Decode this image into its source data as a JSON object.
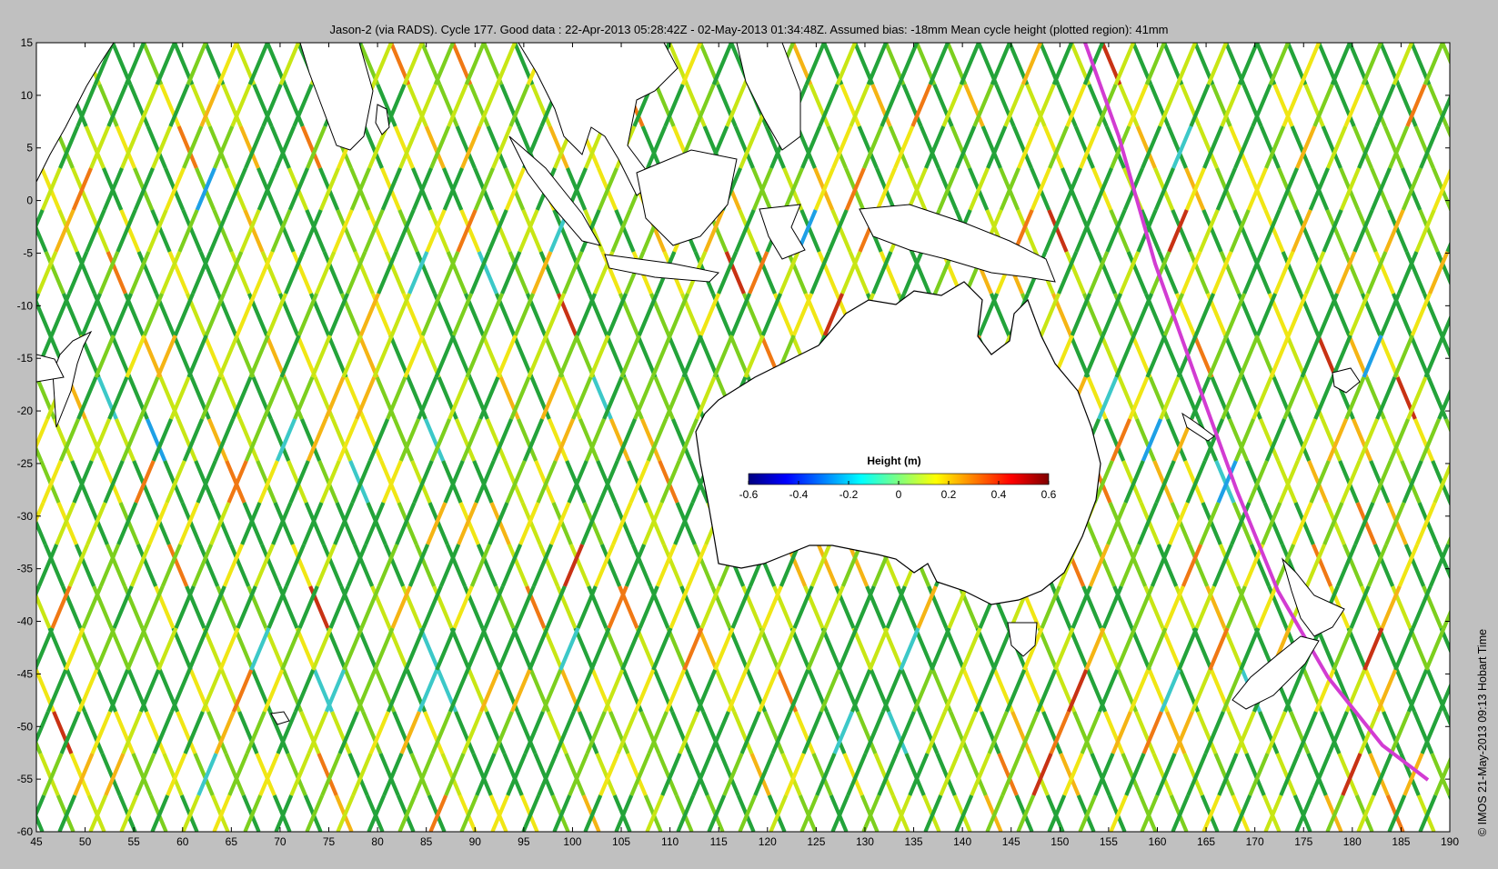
{
  "title": "Jason-2 (via RADS). Cycle 177. Good data : 22-Apr-2013 05:28:42Z - 02-May-2013 01:34:48Z. Assumed bias: -18mm  Mean cycle height (plotted region): 41mm",
  "copyright": "© IMOS 21-May-2013 09:13 Hobart Time",
  "map": {
    "lon_range": [
      45,
      190
    ],
    "lat_range": [
      -60,
      15
    ],
    "x_ticks": [
      45,
      50,
      55,
      60,
      65,
      70,
      75,
      80,
      85,
      90,
      95,
      100,
      105,
      110,
      115,
      120,
      125,
      130,
      135,
      140,
      145,
      150,
      155,
      160,
      165,
      170,
      175,
      180,
      185,
      190
    ],
    "y_ticks": [
      15,
      10,
      5,
      0,
      -5,
      -10,
      -15,
      -20,
      -25,
      -30,
      -35,
      -40,
      -45,
      -50,
      -55,
      -60
    ],
    "land_color": "#ffffff",
    "track_palette": [
      "#3c1fa0",
      "#1ea0e6",
      "#3cc8c8",
      "#23a33a",
      "#7ccf1e",
      "#c8e614",
      "#f0e614",
      "#f5b414",
      "#f07814",
      "#c83214"
    ]
  },
  "colorbar": {
    "title": "Height (m)",
    "ticks": [
      "-0.6",
      "-0.4",
      "-0.2",
      "0",
      "0.2",
      "0.4",
      "0.6"
    ],
    "range": [
      -0.6,
      0.6
    ],
    "colors": [
      "#00007f",
      "#0000ff",
      "#007fff",
      "#00ffff",
      "#7fff7f",
      "#ffff00",
      "#ff7f00",
      "#ff0000",
      "#7f0000"
    ]
  }
}
